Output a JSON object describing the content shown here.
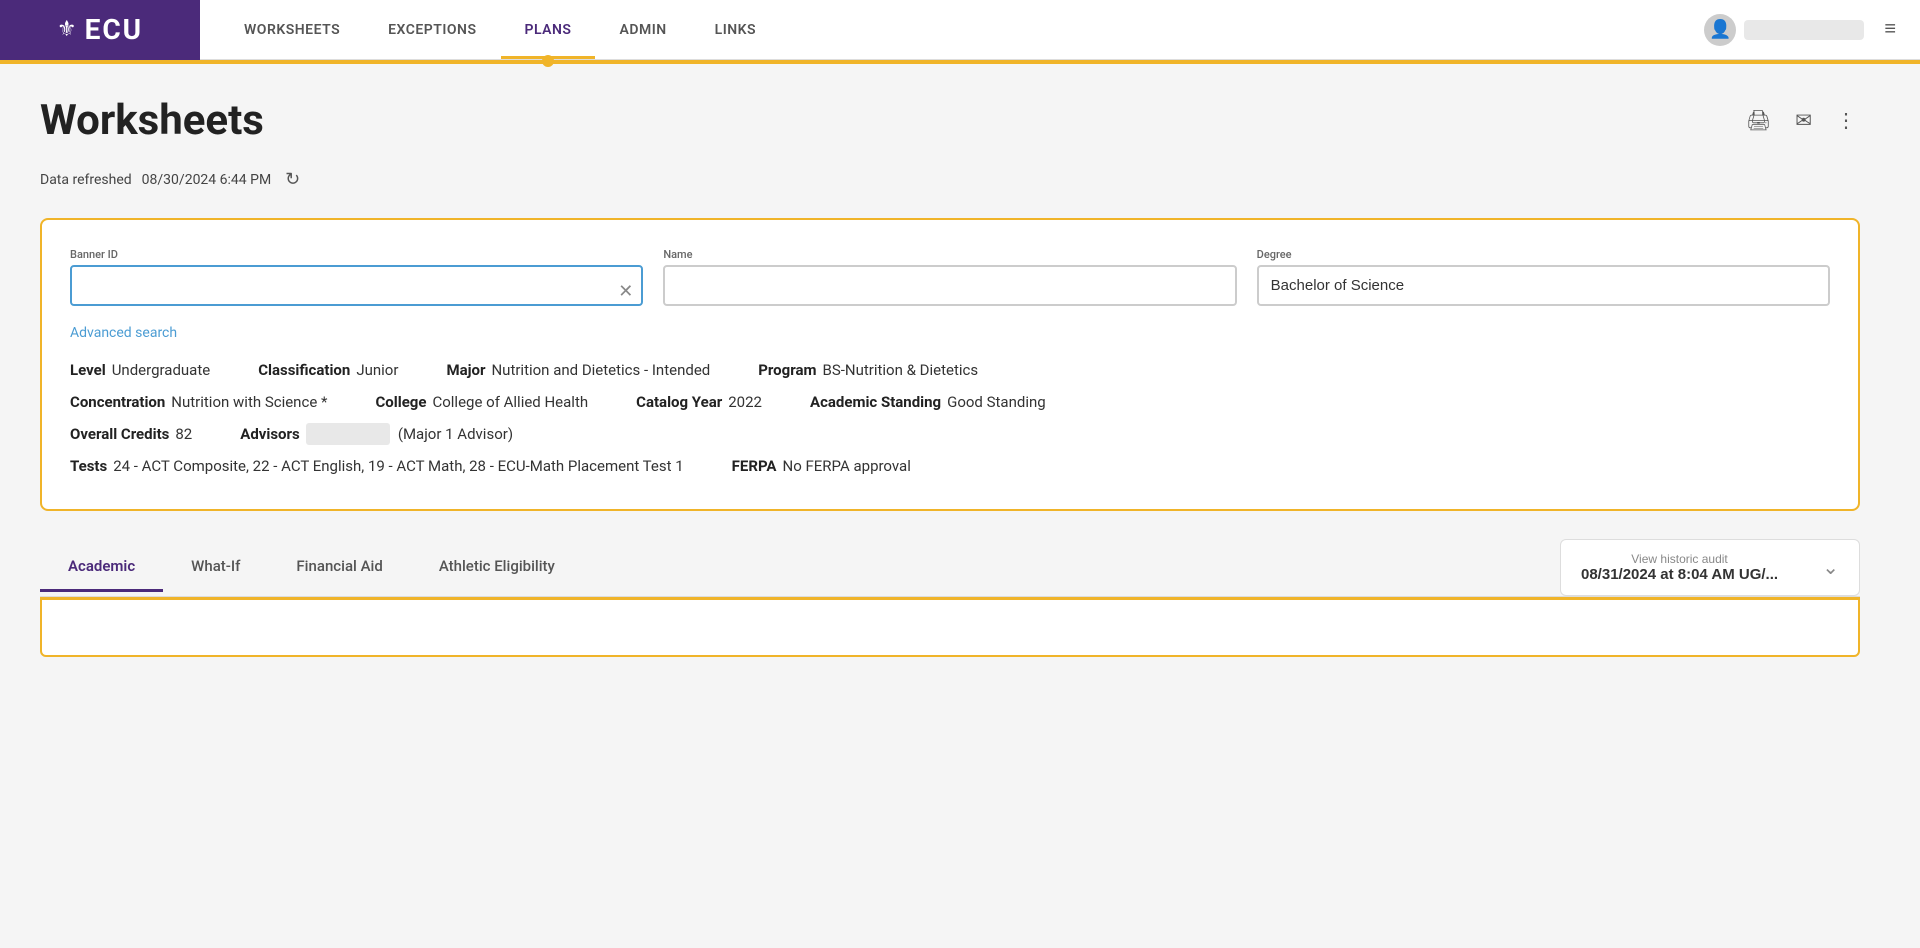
{
  "nav": {
    "logo_text": "ECU",
    "links": [
      {
        "id": "worksheets",
        "label": "WORKSHEETS",
        "active": false
      },
      {
        "id": "exceptions",
        "label": "EXCEPTIONS",
        "active": false
      },
      {
        "id": "plans",
        "label": "PLANS",
        "active": true
      },
      {
        "id": "admin",
        "label": "ADMIN",
        "active": false
      },
      {
        "id": "links",
        "label": "LINKS",
        "active": false
      }
    ],
    "user_name": ""
  },
  "page": {
    "title": "Worksheets",
    "refresh_label": "Data  refreshed",
    "refresh_date": "08/30/2024  6:44  PM"
  },
  "search": {
    "banner_id_label": "Banner ID",
    "banner_id_value": "",
    "banner_id_placeholder": "",
    "name_label": "Name",
    "name_value": "",
    "name_placeholder": "",
    "degree_label": "Degree",
    "degree_value": "Bachelor of Science",
    "advanced_search_label": "Advanced search"
  },
  "student": {
    "level_label": "Level",
    "level_value": "Undergraduate",
    "classification_label": "Classification",
    "classification_value": "Junior",
    "major_label": "Major",
    "major_value": "Nutrition and Dietetics - Intended",
    "program_label": "Program",
    "program_value": "BS-Nutrition & Dietetics",
    "concentration_label": "Concentration",
    "concentration_value": "Nutrition with Science *",
    "college_label": "College",
    "college_value": "College of Allied Health",
    "catalog_year_label": "Catalog Year",
    "catalog_year_value": "2022",
    "academic_standing_label": "Academic Standing",
    "academic_standing_value": "Good Standing",
    "overall_credits_label": "Overall Credits",
    "overall_credits_value": "82",
    "advisors_label": "Advisors",
    "advisors_value": "",
    "advisors_suffix": "(Major 1 Advisor)",
    "tests_label": "Tests",
    "tests_value": "24 - ACT Composite, 22 - ACT English, 19 - ACT Math, 28 - ECU-Math Placement Test 1",
    "ferpa_label": "FERPA",
    "ferpa_value": "No FERPA approval"
  },
  "tabs": [
    {
      "id": "academic",
      "label": "Academic",
      "active": true
    },
    {
      "id": "what-if",
      "label": "What-If",
      "active": false
    },
    {
      "id": "financial-aid",
      "label": "Financial Aid",
      "active": false
    },
    {
      "id": "athletic-eligibility",
      "label": "Athletic Eligibility",
      "active": false
    }
  ],
  "historic_audit": {
    "label": "View historic audit",
    "value": "08/31/2024  at  8:04  AM  UG/..."
  },
  "icons": {
    "print": "🖨",
    "email": "✉",
    "more": "⋮",
    "refresh": "↻",
    "clear": "✕",
    "hamburger": "≡",
    "chevron_down": "⌄",
    "user": "👤"
  }
}
